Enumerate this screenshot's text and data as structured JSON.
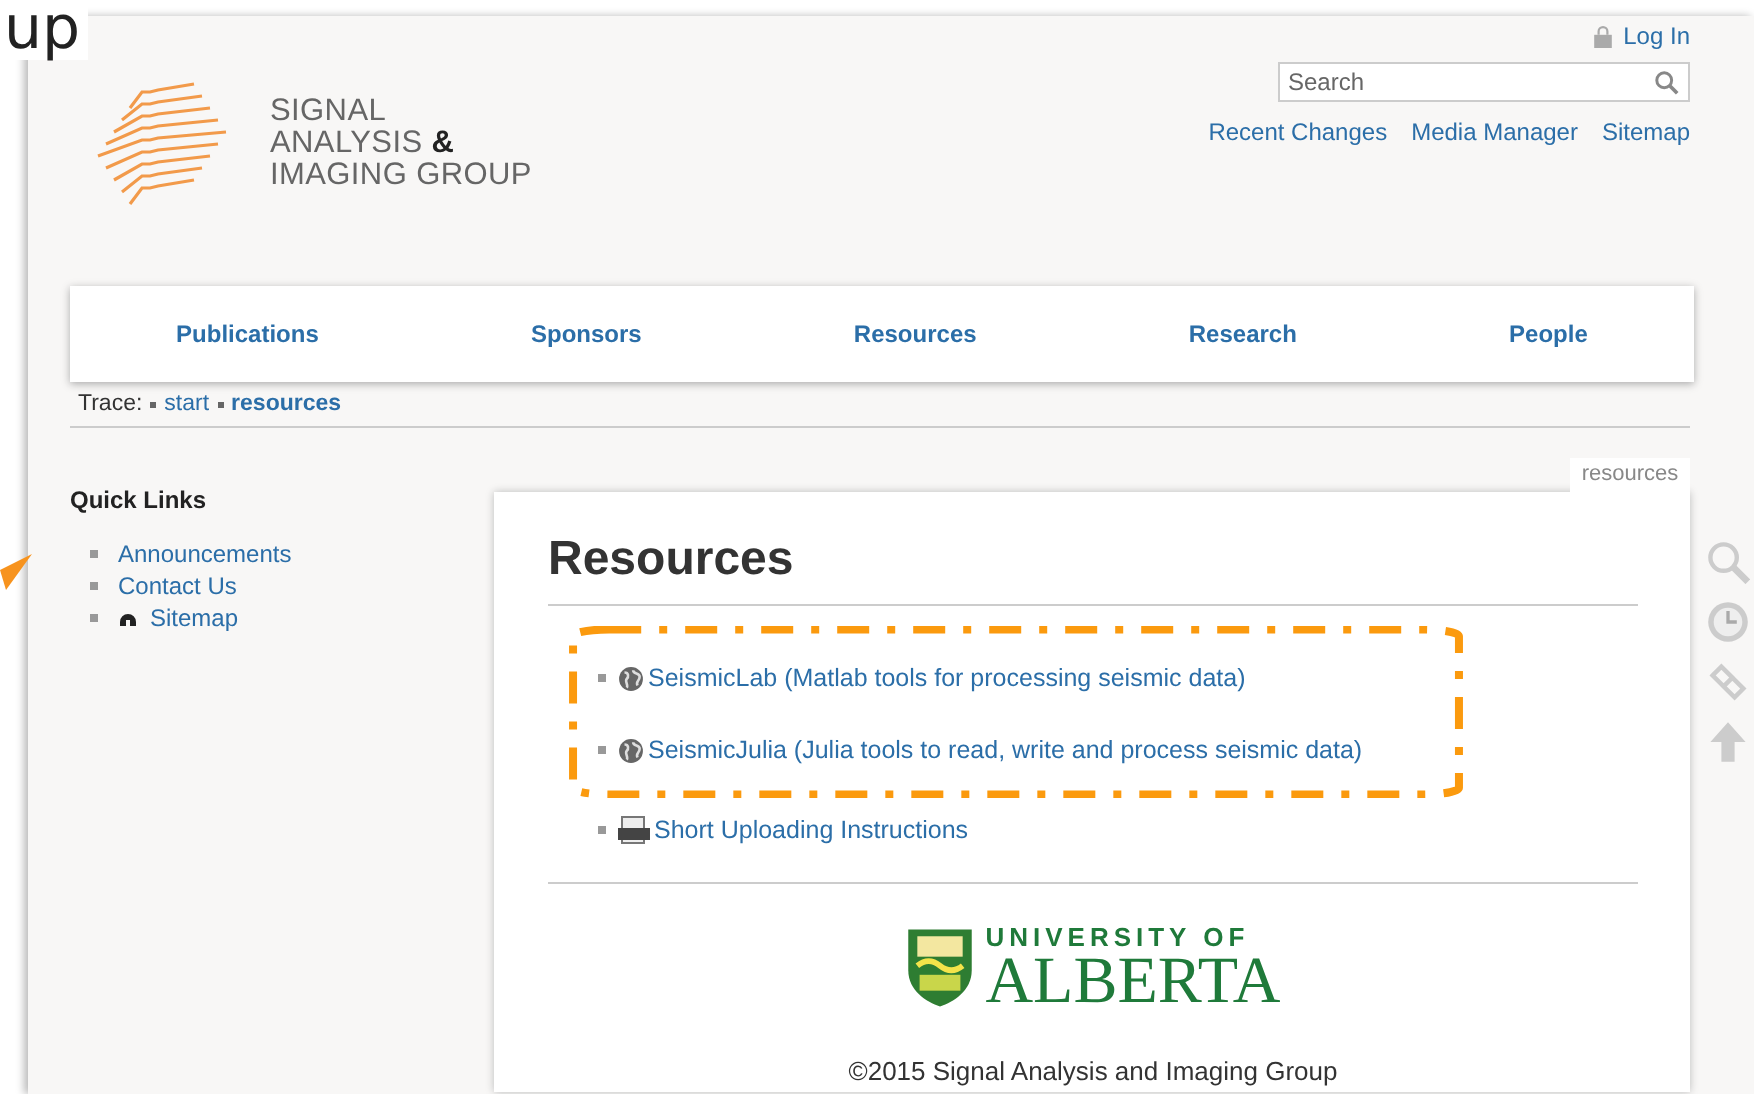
{
  "annotation": {
    "text": "up"
  },
  "header": {
    "logo_lines": [
      "SIGNAL",
      "ANALYSIS **&**",
      "IMAGING GROUP"
    ],
    "login": "Log In",
    "search": {
      "placeholder": "Search"
    },
    "tools": [
      "Recent Changes",
      "Media Manager",
      "Sitemap"
    ]
  },
  "nav": [
    "Publications",
    "Sponsors",
    "Resources",
    "Research",
    "People"
  ],
  "breadcrumb": {
    "label": "Trace:",
    "items": [
      {
        "label": "start",
        "selected": false
      },
      {
        "label": "resources",
        "selected": true
      }
    ]
  },
  "sidebar": {
    "title": "Quick Links",
    "items": [
      {
        "label": "Announcements",
        "kind": "plain"
      },
      {
        "label": "Contact Us",
        "kind": "plain"
      },
      {
        "label": "Sitemap",
        "kind": "sitemap"
      }
    ]
  },
  "page_tab": "resources",
  "content": {
    "title": "Resources",
    "links": [
      {
        "label": "SeismicLab (Matlab tools for processing seismic data)",
        "kind": "external",
        "highlighted": true
      },
      {
        "label": "SeismicJulia (Julia tools to read, write and process seismic data)",
        "kind": "external",
        "highlighted": true
      },
      {
        "label": "Short Uploading Instructions",
        "kind": "pdf",
        "highlighted": false
      }
    ]
  },
  "footer": {
    "logo_top": "UNIVERSITY OF",
    "logo_bottom": "ALBERTA",
    "copyright": "©2015 Signal Analysis and Imaging Group"
  }
}
